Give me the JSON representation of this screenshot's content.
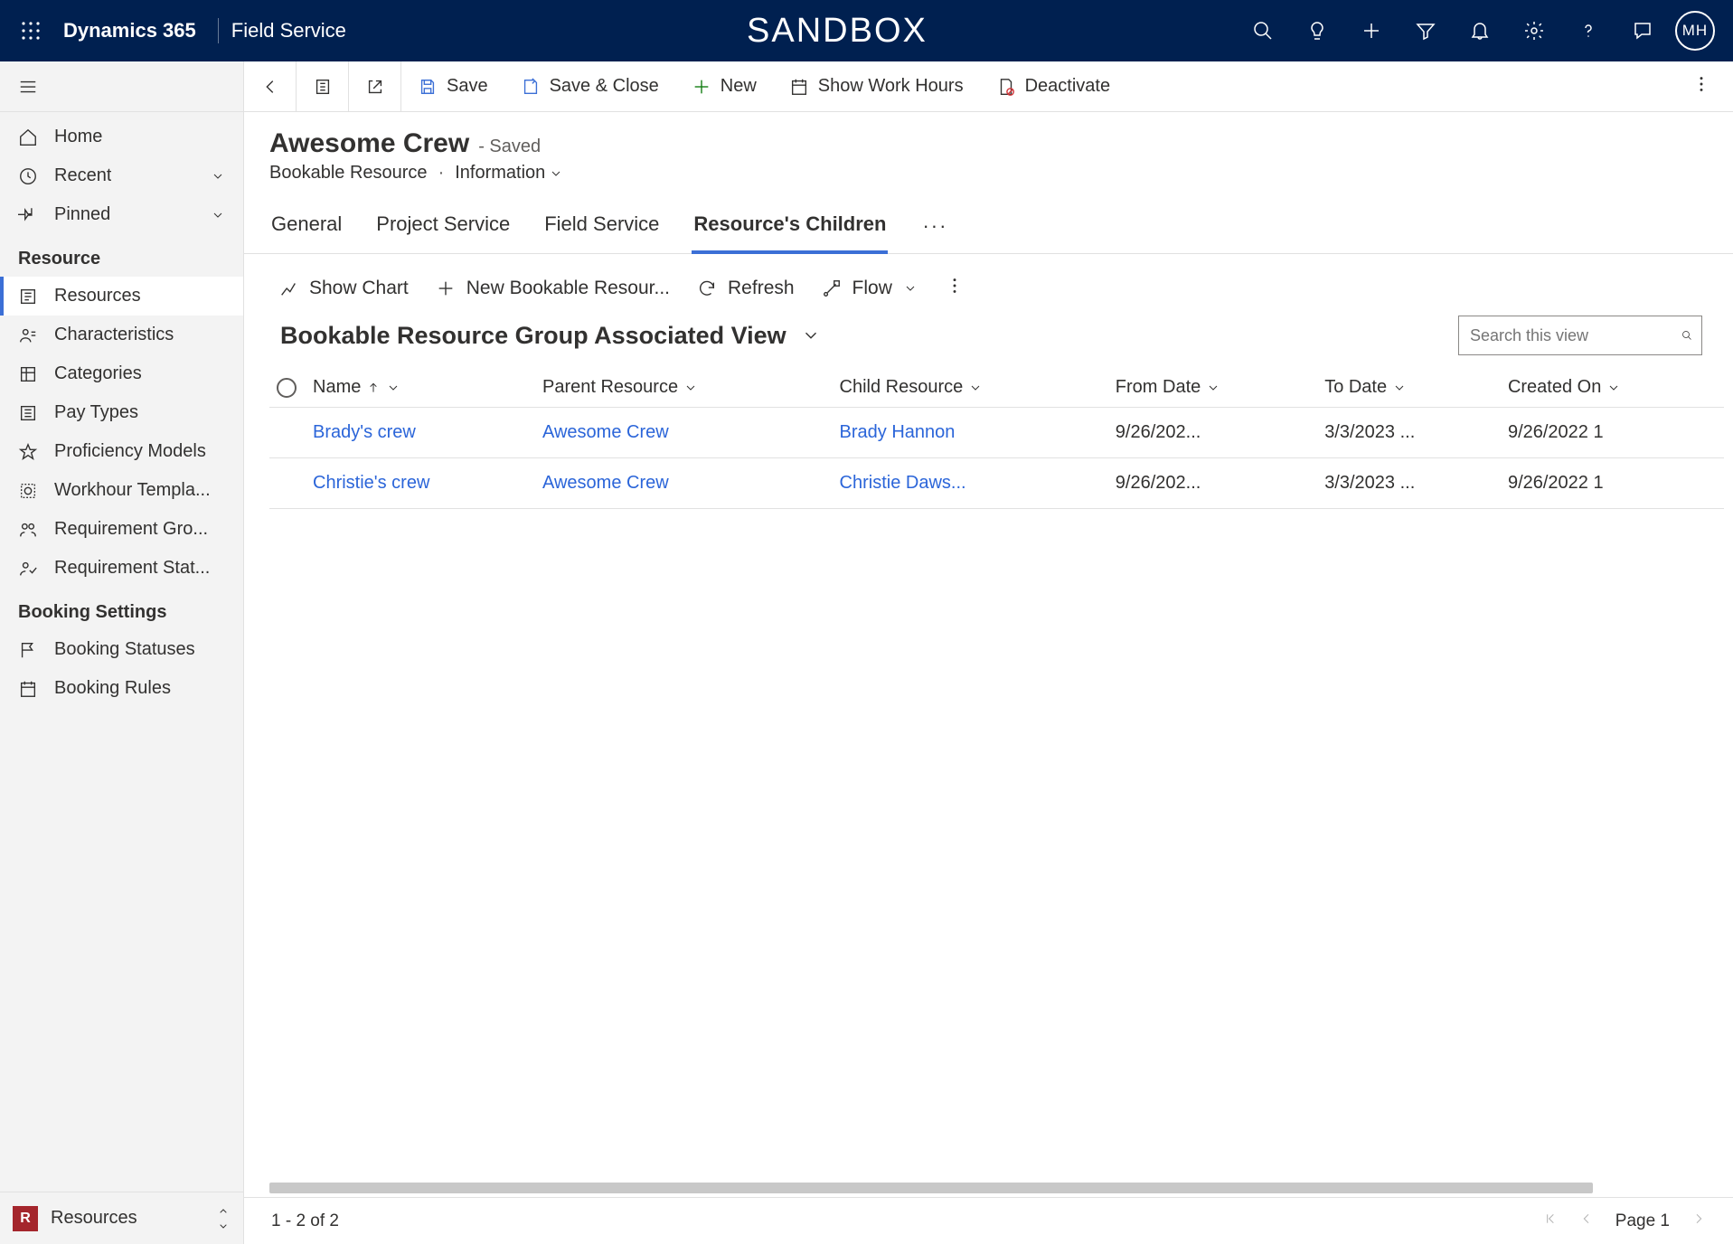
{
  "topbar": {
    "brand": "Dynamics 365",
    "app": "Field Service",
    "environment": "SANDBOX",
    "avatar_initials": "MH"
  },
  "sidebar": {
    "top_items": [
      {
        "id": "home",
        "label": "Home"
      },
      {
        "id": "recent",
        "label": "Recent",
        "expandable": true
      },
      {
        "id": "pinned",
        "label": "Pinned",
        "expandable": true
      }
    ],
    "groups": [
      {
        "title": "Resource",
        "items": [
          {
            "id": "resources",
            "label": "Resources",
            "active": true
          },
          {
            "id": "characteristics",
            "label": "Characteristics"
          },
          {
            "id": "categories",
            "label": "Categories"
          },
          {
            "id": "paytypes",
            "label": "Pay Types"
          },
          {
            "id": "proficiency",
            "label": "Proficiency Models"
          },
          {
            "id": "workhour",
            "label": "Workhour Templa..."
          },
          {
            "id": "reqgroups",
            "label": "Requirement Gro..."
          },
          {
            "id": "reqstatus",
            "label": "Requirement Stat..."
          }
        ]
      },
      {
        "title": "Booking Settings",
        "items": [
          {
            "id": "bookingstatuses",
            "label": "Booking Statuses"
          },
          {
            "id": "bookingrules",
            "label": "Booking Rules"
          }
        ]
      }
    ],
    "area": {
      "badge": "R",
      "label": "Resources"
    }
  },
  "commandbar": {
    "save": "Save",
    "save_close": "Save & Close",
    "new": "New",
    "show_work_hours": "Show Work Hours",
    "deactivate": "Deactivate"
  },
  "record": {
    "title": "Awesome Crew",
    "status": "- Saved",
    "entity": "Bookable Resource",
    "form": "Information"
  },
  "tabs": [
    {
      "label": "General"
    },
    {
      "label": "Project Service"
    },
    {
      "label": "Field Service"
    },
    {
      "label": "Resource's Children",
      "active": true
    }
  ],
  "subgrid_cmd": {
    "show_chart": "Show Chart",
    "new_record": "New Bookable Resour...",
    "refresh": "Refresh",
    "flow": "Flow"
  },
  "view": {
    "name": "Bookable Resource Group Associated View",
    "search_placeholder": "Search this view"
  },
  "grid": {
    "columns": [
      {
        "key": "name",
        "label": "Name",
        "sort": "asc"
      },
      {
        "key": "parent",
        "label": "Parent Resource"
      },
      {
        "key": "child",
        "label": "Child Resource"
      },
      {
        "key": "from",
        "label": "From Date"
      },
      {
        "key": "to",
        "label": "To Date"
      },
      {
        "key": "created",
        "label": "Created On"
      }
    ],
    "rows": [
      {
        "name": "Brady's crew",
        "parent": "Awesome Crew",
        "child": "Brady Hannon",
        "from": "9/26/202...",
        "to": "3/3/2023 ...",
        "created": "9/26/2022 1"
      },
      {
        "name": "Christie's crew",
        "parent": "Awesome Crew",
        "child": "Christie Daws...",
        "from": "9/26/202...",
        "to": "3/3/2023 ...",
        "created": "9/26/2022 1"
      }
    ]
  },
  "footer": {
    "range": "1 - 2 of 2",
    "page": "Page 1"
  }
}
